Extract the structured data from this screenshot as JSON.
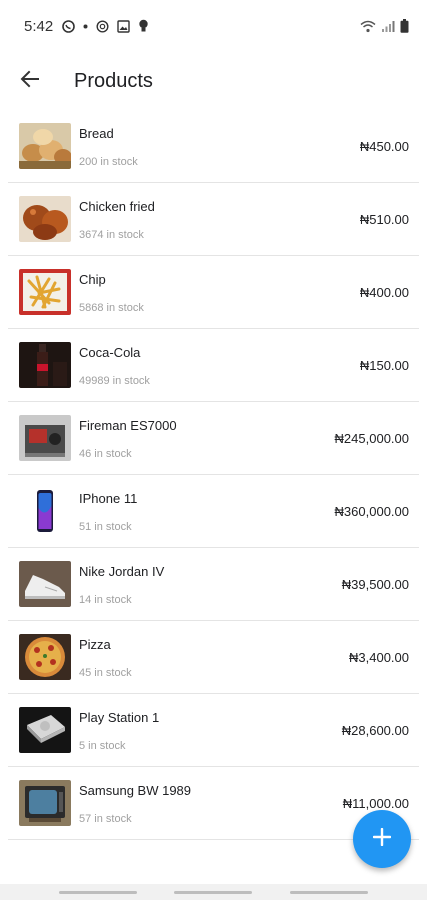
{
  "status_bar": {
    "time": "5:42",
    "left_icons": [
      "whatsapp-icon",
      "dot-icon",
      "sync-icon",
      "gallery-icon",
      "bulb-icon"
    ],
    "right_icons": [
      "wifi-icon",
      "signal-icon",
      "battery-icon"
    ]
  },
  "header": {
    "title": "Products",
    "back_icon": "arrow-back-icon"
  },
  "products": [
    {
      "name": "Bread",
      "stock": "200 in stock",
      "price": "₦450.00",
      "image": "bread-image"
    },
    {
      "name": "Chicken fried",
      "stock": "3674 in stock",
      "price": "₦510.00",
      "image": "chicken-image"
    },
    {
      "name": "Chip",
      "stock": "5868 in stock",
      "price": "₦400.00",
      "image": "chips-image"
    },
    {
      "name": "Coca-Cola",
      "stock": "49989 in stock",
      "price": "₦150.00",
      "image": "coca-cola-image"
    },
    {
      "name": "Fireman ES7000",
      "stock": "46 in stock",
      "price": "₦245,000.00",
      "image": "generator-image"
    },
    {
      "name": "IPhone 11",
      "stock": "51 in stock",
      "price": "₦360,000.00",
      "image": "iphone-image"
    },
    {
      "name": "Nike Jordan IV",
      "stock": "14 in stock",
      "price": "₦39,500.00",
      "image": "sneaker-image"
    },
    {
      "name": "Pizza",
      "stock": "45 in stock",
      "price": "₦3,400.00",
      "image": "pizza-image"
    },
    {
      "name": "Play Station 1",
      "stock": "5 in stock",
      "price": "₦28,600.00",
      "image": "playstation-image"
    },
    {
      "name": "Samsung BW 1989",
      "stock": "57 in stock",
      "price": "₦11,000.00",
      "image": "tv-image"
    }
  ],
  "fab": {
    "icon": "plus-icon",
    "color": "#2196f3"
  }
}
